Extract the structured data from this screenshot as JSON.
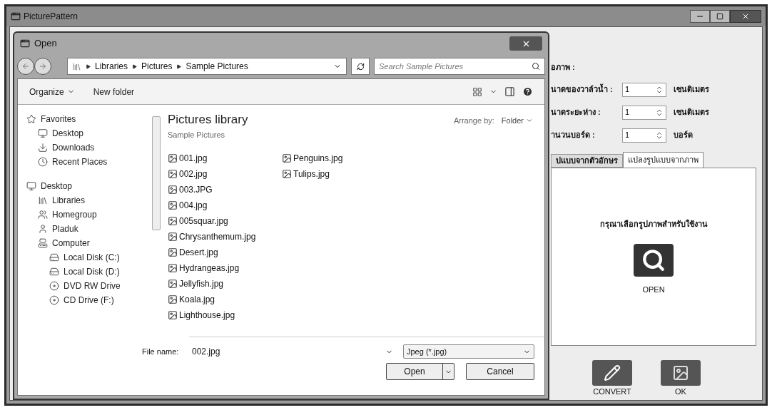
{
  "window": {
    "title": "PicturePattern"
  },
  "dialog": {
    "title": "Open",
    "breadcrumb": [
      "Libraries",
      "Pictures",
      "Sample Pictures"
    ],
    "search": {
      "placeholder": "Search Sample Pictures"
    },
    "toolbar": {
      "organize": "Organize",
      "new_folder": "New folder"
    },
    "nav_tree": [
      {
        "label": "Favorites",
        "kind": "star",
        "children": [
          {
            "label": "Desktop",
            "kind": "desktop"
          },
          {
            "label": "Downloads",
            "kind": "download"
          },
          {
            "label": "Recent Places",
            "kind": "recent"
          }
        ]
      },
      {
        "label": "Desktop",
        "kind": "desktop",
        "children": [
          {
            "label": "Libraries",
            "kind": "libraries"
          },
          {
            "label": "Homegroup",
            "kind": "homegroup"
          },
          {
            "label": "Pladuk",
            "kind": "user"
          },
          {
            "label": "Computer",
            "kind": "computer",
            "children": [
              {
                "label": "Local Disk (C:)",
                "kind": "disk"
              },
              {
                "label": "Local Disk (D:)",
                "kind": "disk"
              },
              {
                "label": "DVD RW Drive",
                "kind": "dvd"
              },
              {
                "label": "CD Drive (F:)",
                "kind": "dvd"
              }
            ]
          }
        ]
      }
    ],
    "library": {
      "title": "Pictures library",
      "subtitle": "Sample Pictures",
      "arrange_label": "Arrange by:",
      "arrange_value": "Folder"
    },
    "files": [
      "001.jpg",
      "002.jpg",
      "003.JPG",
      "004.jpg",
      "005squar.jpg",
      "Chrysanthemum.jpg",
      "Desert.jpg",
      "Hydrangeas.jpg",
      "Jellyfish.jpg",
      "Koala.jpg",
      "Lighthouse.jpg",
      "Penguins.jpg",
      "Tulips.jpg"
    ],
    "file_name": {
      "label": "File name:",
      "value": "002.jpg"
    },
    "filter": "Jpeg (*.jpg)",
    "buttons": {
      "open": "Open",
      "cancel": "Cancel"
    }
  },
  "panel": {
    "section_label": "อภาพ :",
    "fields": [
      {
        "label": "นาดของวาล์วน้ำ :",
        "value": "1",
        "unit": "เซนติเมตร"
      },
      {
        "label": "นาดระยะห่าง :",
        "value": "1",
        "unit": "เซนติเมตร"
      },
      {
        "label": "านวนบอร์ด :",
        "value": "1",
        "unit": "บอร์ด"
      }
    ],
    "tabs": [
      {
        "label": "ปแบบจากตัวอักษร",
        "selected": false
      },
      {
        "label": "แปลงรูปแบบจากภาพ",
        "selected": true
      }
    ],
    "instruction": "กรุณาเลือกรูปภาพสำหรับใช้งาน",
    "open_button": "OPEN",
    "buttons": [
      {
        "label": "CONVERT",
        "kind": "convert"
      },
      {
        "label": "OK",
        "kind": "ok"
      }
    ]
  }
}
